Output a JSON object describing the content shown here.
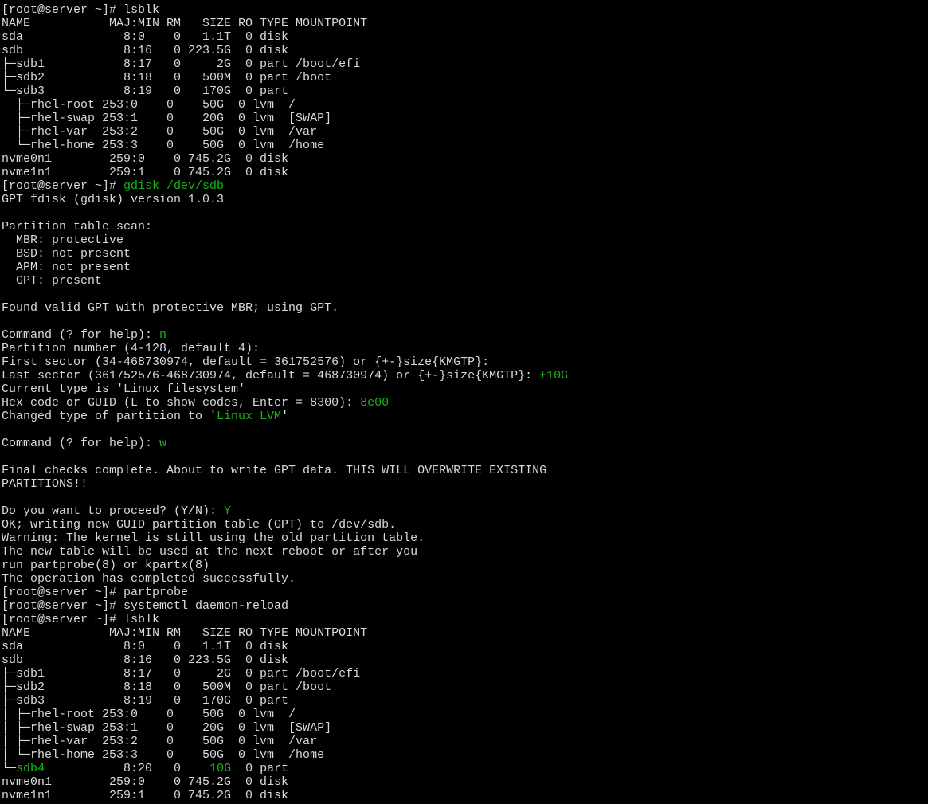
{
  "window": {
    "title": "[root@server ~]"
  },
  "colors": {
    "background": "#000000",
    "foreground": "#d9d9d9",
    "highlight": "#19b319"
  },
  "lines": [
    [
      {
        "t": "[root@server ~]# lsblk"
      }
    ],
    [
      {
        "t": "NAME           MAJ:MIN RM   SIZE RO TYPE MOUNTPOINT"
      }
    ],
    [
      {
        "t": "sda              8:0    0   1.1T  0 disk"
      }
    ],
    [
      {
        "t": "sdb              8:16   0 223.5G  0 disk"
      }
    ],
    [
      {
        "t": "├─sdb1           8:17   0     2G  0 part /boot/efi"
      }
    ],
    [
      {
        "t": "├─sdb2           8:18   0   500M  0 part /boot"
      }
    ],
    [
      {
        "t": "└─sdb3           8:19   0   170G  0 part"
      }
    ],
    [
      {
        "t": "  ├─rhel-root 253:0    0    50G  0 lvm  /"
      }
    ],
    [
      {
        "t": "  ├─rhel-swap 253:1    0    20G  0 lvm  [SWAP]"
      }
    ],
    [
      {
        "t": "  ├─rhel-var  253:2    0    50G  0 lvm  /var"
      }
    ],
    [
      {
        "t": "  └─rhel-home 253:3    0    50G  0 lvm  /home"
      }
    ],
    [
      {
        "t": "nvme0n1        259:0    0 745.2G  0 disk"
      }
    ],
    [
      {
        "t": "nvme1n1        259:1    0 745.2G  0 disk"
      }
    ],
    [
      {
        "t": "[root@server ~]# "
      },
      {
        "t": "gdisk /dev/sdb",
        "hl": true
      }
    ],
    [
      {
        "t": "GPT fdisk (gdisk) version 1.0.3"
      }
    ],
    [
      {
        "t": ""
      }
    ],
    [
      {
        "t": "Partition table scan:"
      }
    ],
    [
      {
        "t": "  MBR: protective"
      }
    ],
    [
      {
        "t": "  BSD: not present"
      }
    ],
    [
      {
        "t": "  APM: not present"
      }
    ],
    [
      {
        "t": "  GPT: present"
      }
    ],
    [
      {
        "t": ""
      }
    ],
    [
      {
        "t": "Found valid GPT with protective MBR; using GPT."
      }
    ],
    [
      {
        "t": ""
      }
    ],
    [
      {
        "t": "Command (? for help): "
      },
      {
        "t": "n",
        "hl": true
      }
    ],
    [
      {
        "t": "Partition number (4-128, default 4):"
      }
    ],
    [
      {
        "t": "First sector (34-468730974, default = 361752576) or {+-}size{KMGTP}:"
      }
    ],
    [
      {
        "t": "Last sector (361752576-468730974, default = 468730974) or {+-}size{KMGTP}: "
      },
      {
        "t": "+10G",
        "hl": true
      }
    ],
    [
      {
        "t": "Current type is 'Linux filesystem'"
      }
    ],
    [
      {
        "t": "Hex code or GUID (L to show codes, Enter = 8300): "
      },
      {
        "t": "8e00",
        "hl": true
      }
    ],
    [
      {
        "t": "Changed type of partition to '"
      },
      {
        "t": "Linux LVM",
        "hl": true
      },
      {
        "t": "'"
      }
    ],
    [
      {
        "t": ""
      }
    ],
    [
      {
        "t": "Command (? for help): "
      },
      {
        "t": "w",
        "hl": true
      }
    ],
    [
      {
        "t": ""
      }
    ],
    [
      {
        "t": "Final checks complete. About to write GPT data. THIS WILL OVERWRITE EXISTING"
      }
    ],
    [
      {
        "t": "PARTITIONS!!"
      }
    ],
    [
      {
        "t": ""
      }
    ],
    [
      {
        "t": "Do you want to proceed? (Y/N): "
      },
      {
        "t": "Y",
        "hl": true
      }
    ],
    [
      {
        "t": "OK; writing new GUID partition table (GPT) to /dev/sdb."
      }
    ],
    [
      {
        "t": "Warning: The kernel is still using the old partition table."
      }
    ],
    [
      {
        "t": "The new table will be used at the next reboot or after you"
      }
    ],
    [
      {
        "t": "run partprobe(8) or kpartx(8)"
      }
    ],
    [
      {
        "t": "The operation has completed successfully."
      }
    ],
    [
      {
        "t": "[root@server ~]# partprobe"
      }
    ],
    [
      {
        "t": "[root@server ~]# systemctl daemon-reload"
      }
    ],
    [
      {
        "t": "[root@server ~]# lsblk"
      }
    ],
    [
      {
        "t": "NAME           MAJ:MIN RM   SIZE RO TYPE MOUNTPOINT"
      }
    ],
    [
      {
        "t": "sda              8:0    0   1.1T  0 disk"
      }
    ],
    [
      {
        "t": "sdb              8:16   0 223.5G  0 disk"
      }
    ],
    [
      {
        "t": "├─sdb1           8:17   0     2G  0 part /boot/efi"
      }
    ],
    [
      {
        "t": "├─sdb2           8:18   0   500M  0 part /boot"
      }
    ],
    [
      {
        "t": "├─sdb3           8:19   0   170G  0 part"
      }
    ],
    [
      {
        "t": "│ ├─rhel-root 253:0    0    50G  0 lvm  /"
      }
    ],
    [
      {
        "t": "│ ├─rhel-swap 253:1    0    20G  0 lvm  [SWAP]"
      }
    ],
    [
      {
        "t": "│ ├─rhel-var  253:2    0    50G  0 lvm  /var"
      }
    ],
    [
      {
        "t": "│ └─rhel-home 253:3    0    50G  0 lvm  /home"
      }
    ],
    [
      {
        "t": "└─"
      },
      {
        "t": "sdb4",
        "hl": true
      },
      {
        "t": "           8:20   0    "
      },
      {
        "t": "10G",
        "hl": true
      },
      {
        "t": "  0 part"
      }
    ],
    [
      {
        "t": "nvme0n1        259:0    0 745.2G  0 disk"
      }
    ],
    [
      {
        "t": "nvme1n1        259:1    0 745.2G  0 disk"
      }
    ]
  ]
}
